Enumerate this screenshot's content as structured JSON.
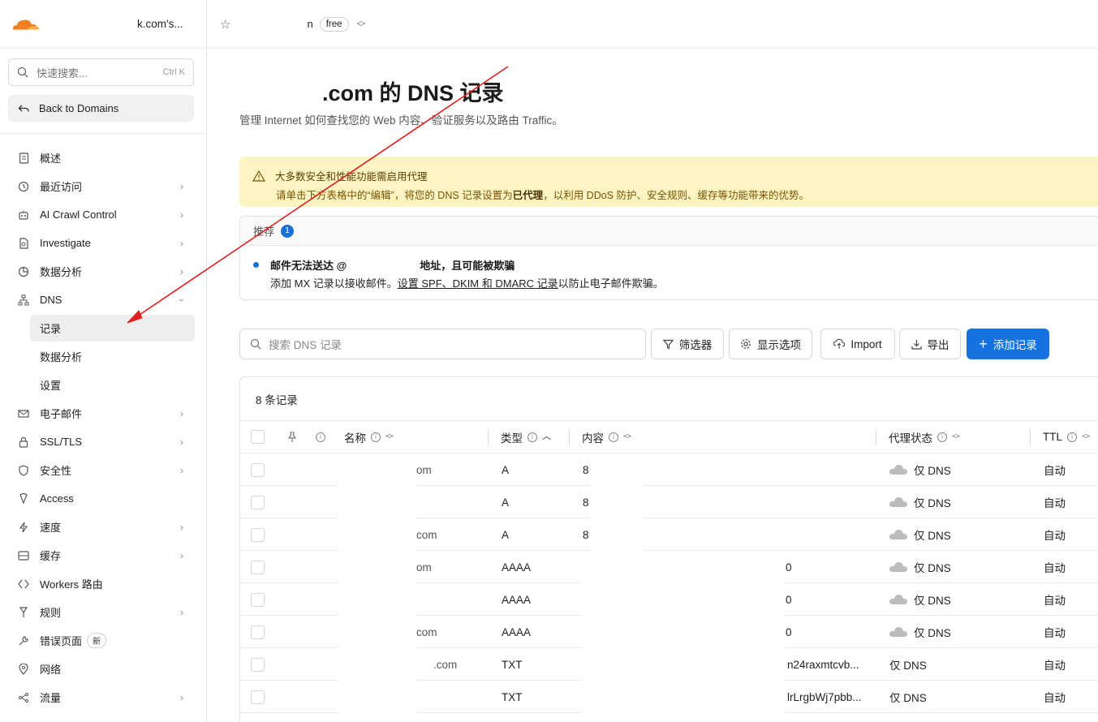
{
  "sidebar": {
    "account_name": "k.com's...",
    "search_placeholder": "快速搜索...",
    "search_shortcut": "Ctrl K",
    "back_label": "Back to Domains",
    "items": [
      {
        "label": "概述",
        "icon": "document-icon",
        "chevron": false
      },
      {
        "label": "最近访问",
        "icon": "history-icon",
        "chevron": true
      },
      {
        "label": "AI Crawl Control",
        "icon": "robot-icon",
        "chevron": true
      },
      {
        "label": "Investigate",
        "icon": "investigate-icon",
        "chevron": true
      },
      {
        "label": "数据分析",
        "icon": "pie-chart-icon",
        "chevron": true
      },
      {
        "label": "DNS",
        "icon": "network-icon",
        "chevron": "open"
      }
    ],
    "dns_sub": [
      "记录",
      "数据分析",
      "设置"
    ],
    "items_after": [
      {
        "label": "电子邮件",
        "icon": "email-icon",
        "chevron": true
      },
      {
        "label": "SSL/TLS",
        "icon": "lock-icon",
        "chevron": true
      },
      {
        "label": "安全性",
        "icon": "shield-icon",
        "chevron": true
      },
      {
        "label": "Access",
        "icon": "access-icon",
        "chevron": false
      },
      {
        "label": "速度",
        "icon": "lightning-icon",
        "chevron": true
      },
      {
        "label": "缓存",
        "icon": "storage-icon",
        "chevron": true
      },
      {
        "label": "Workers 路由",
        "icon": "workers-icon",
        "chevron": false
      },
      {
        "label": "规则",
        "icon": "rules-icon",
        "chevron": true
      },
      {
        "label": "错误页面",
        "icon": "wrench-icon",
        "chevron": false,
        "badge": "新"
      },
      {
        "label": "网络",
        "icon": "location-icon",
        "chevron": false
      },
      {
        "label": "流量",
        "icon": "traffic-icon",
        "chevron": true
      }
    ]
  },
  "topbar": {
    "zone_tail": "n",
    "plan": "free"
  },
  "main": {
    "title_tail": ".com 的 DNS 记录",
    "subtitle": "管理 Internet 如何查找您的 Web 内容、验证服务以及路由 Traffic。",
    "warning": {
      "title": "大多数安全和性能功能需启用代理",
      "text_before": "请单击下方表格中的“编辑”，将您的 DNS 记录设置为",
      "text_bold": "已代理",
      "text_after": "，以利用 DDoS 防护、安全规则、缓存等功能带来的优势。"
    },
    "recommend": {
      "header": "推荐",
      "count": "1",
      "line1_before": "邮件无法送达 @",
      "line1_after": "地址，且可能被欺骗",
      "line2_before": "添加 MX 记录以接收邮件。",
      "line2_link": "设置 SPF、DKIM 和 DMARC 记录",
      "line2_after": "以防止电子邮件欺骗。"
    },
    "toolbar": {
      "search_placeholder": "搜索 DNS 记录",
      "filter": "筛选器",
      "display": "显示选项",
      "import": "Import",
      "export": "导出",
      "add": "添加记录"
    },
    "table": {
      "count": "8 条记录",
      "headers": {
        "name": "名称",
        "type": "类型",
        "content": "内容",
        "proxy": "代理状态",
        "ttl": "TTL"
      },
      "rows": [
        {
          "name": "om",
          "type": "A",
          "content": "8",
          "proxy": "仅 DNS",
          "cloud": true,
          "ttl": "自动"
        },
        {
          "name": "",
          "type": "A",
          "content": "8",
          "proxy": "仅 DNS",
          "cloud": true,
          "ttl": "自动"
        },
        {
          "name": "com",
          "type": "A",
          "content": "8",
          "proxy": "仅 DNS",
          "cloud": true,
          "ttl": "自动"
        },
        {
          "name": "om",
          "type": "AAAA",
          "content": "0",
          "proxy": "仅 DNS",
          "cloud": true,
          "ttl": "自动"
        },
        {
          "name": "",
          "type": "AAAA",
          "content": "0",
          "proxy": "仅 DNS",
          "cloud": true,
          "ttl": "自动"
        },
        {
          "name": "com",
          "type": "AAAA",
          "content": "0",
          "proxy": "仅 DNS",
          "cloud": true,
          "ttl": "自动"
        },
        {
          "name": ".com",
          "type": "TXT",
          "content": "n24raxmtcvb...",
          "proxy": "仅 DNS",
          "cloud": false,
          "ttl": "自动"
        },
        {
          "name": "",
          "type": "TXT",
          "content": "lrLrgbWj7pbb...",
          "proxy": "仅 DNS",
          "cloud": false,
          "ttl": "自动"
        }
      ]
    }
  },
  "colors": {
    "accent": "#1672e0",
    "warning_bg": "#fdf4c4",
    "logo": "#f38020",
    "arrow": "#e02020"
  }
}
